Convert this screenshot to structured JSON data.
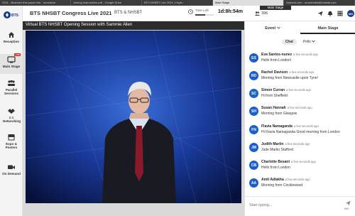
{
  "browser": {
    "tabs": [
      {
        "label": "2021 - Bushra's free paper link - mureeeta",
        "active": false
      },
      {
        "label": "Joining Instructions.pdf - Google Drive",
        "active": false
      },
      {
        "label": "BTS NHSBT Live 2021 | Hopin",
        "active": false
      },
      {
        "label": "Main Stage",
        "active": true
      },
      {
        "label": "Outlook.com - mureeetab@hotmail.com",
        "active": false
      }
    ]
  },
  "header": {
    "title": "BTS NHSBT Congress Live 2021",
    "org": "BTS & NHSBT",
    "time_left_label": "Time Left",
    "time_left_value": "1d:8h:54m",
    "time_left_progress": 0.55,
    "viewer_count": "396",
    "user_initials": "MS",
    "stage_title": "Main Stage"
  },
  "sidebar": {
    "items": [
      {
        "label": "Reception",
        "icon": "home-icon"
      },
      {
        "label": "Main Stage",
        "icon": "stage-icon",
        "active": true,
        "badge": "LIVE"
      },
      {
        "label": "Parallel Sessions",
        "icon": "sessions-icon"
      },
      {
        "label": "1:1 Networking",
        "icon": "networking-icon"
      },
      {
        "label": "Expo & Posters",
        "icon": "expo-icon"
      },
      {
        "label": "On Demand",
        "icon": "video-camera-icon"
      }
    ]
  },
  "video": {
    "title": "Virtual BTS NHSBT Opening Session with Sammie Allen"
  },
  "panel": {
    "tabs": [
      "Event",
      "Main Stage"
    ],
    "active_tab": "Main Stage",
    "subtabs": [
      "Chat",
      "Polls"
    ],
    "active_subtab": "Chat",
    "messages": [
      {
        "initials": "ES",
        "name": "Eva Santos-nunez",
        "time": "a few seconds ago",
        "text": "Hello from London!"
      },
      {
        "initials": "RD",
        "name": "Rachel Davison",
        "time": "a few seconds ago",
        "text": "Morning from Newcastle upon Tyne!"
      },
      {
        "initials": "SC",
        "name": "Simon Curran",
        "time": "a few seconds ago",
        "text": "Hi from Sheffield"
      },
      {
        "initials": "SH",
        "name": "Susan Hannah",
        "time": "a few seconds ago",
        "text": "Morning from Glasgow"
      },
      {
        "initials": "FN",
        "name": "Flavia Namaganda",
        "time": "a few seconds ago",
        "text": "Hi Flavia Namaganda Good morning from London"
      },
      {
        "initials": "JM",
        "name": "Judith Martin",
        "time": "a few seconds ago",
        "text": "Jude Martin Stafford"
      },
      {
        "initials": "CB",
        "name": "Charlotte Besant",
        "time": "a few seconds ago",
        "text": "Hello from London"
      },
      {
        "initials": "AA",
        "name": "Amit Adlakha",
        "time": "a few seconds ago",
        "text": "Morning from Cricklewood"
      }
    ],
    "input_placeholder": "Start typing...",
    "char_limit": "500"
  },
  "colors": {
    "accent": "#1d5fc9",
    "live": "#d92020",
    "video_bg": "#0b1a4d"
  }
}
